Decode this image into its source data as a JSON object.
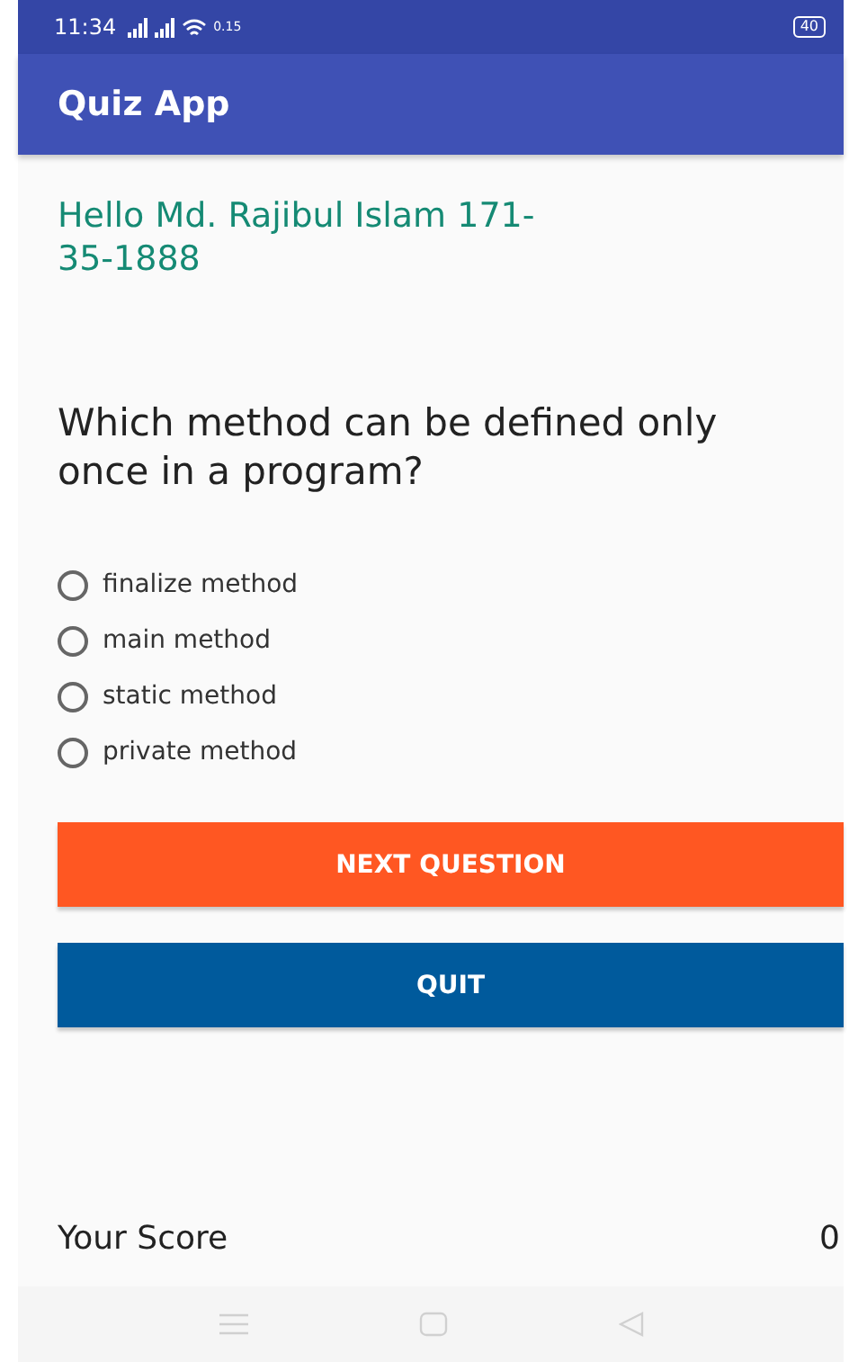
{
  "status_bar": {
    "time": "11:34",
    "speed": "0.15",
    "battery": "40"
  },
  "app_bar": {
    "title": "Quiz App"
  },
  "greeting": "Hello Md. Rajibul Islam 171-35-1888",
  "question": "Which method can be defined only once in a program?",
  "options": [
    {
      "label": "finalize method",
      "selected": false
    },
    {
      "label": "main method",
      "selected": false
    },
    {
      "label": "static method",
      "selected": false
    },
    {
      "label": "private method",
      "selected": false
    }
  ],
  "buttons": [
    {
      "label": "NEXT QUESTION",
      "kind": "next"
    },
    {
      "label": "QUIT",
      "kind": "quit"
    }
  ],
  "score": {
    "label": "Your Score",
    "value": "0"
  }
}
